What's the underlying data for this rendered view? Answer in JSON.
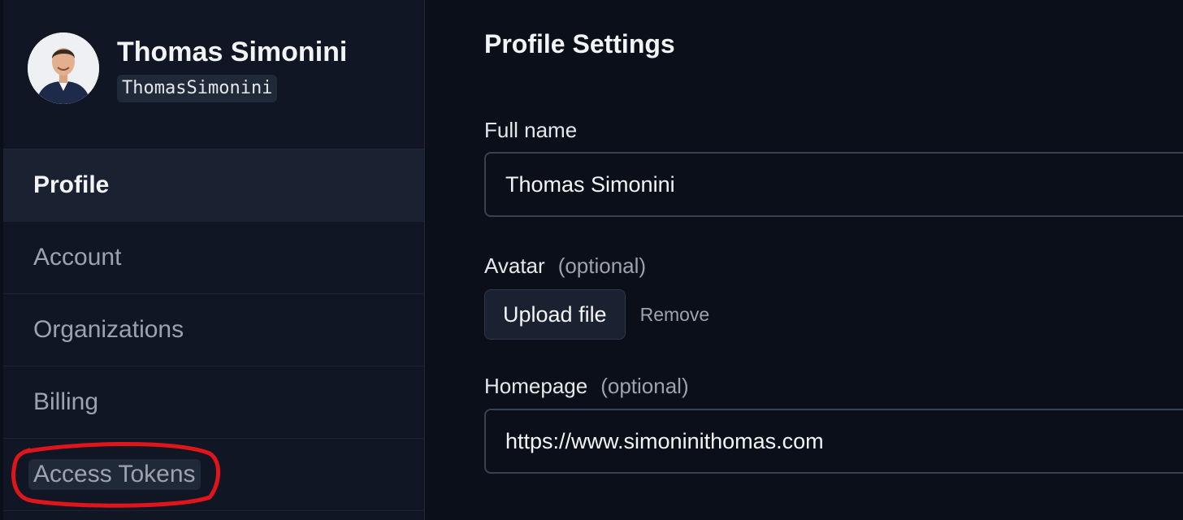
{
  "user": {
    "name": "Thomas Simonini",
    "handle": "ThomasSimonini"
  },
  "sidebar": {
    "items": [
      {
        "label": "Profile",
        "active": true
      },
      {
        "label": "Account"
      },
      {
        "label": "Organizations"
      },
      {
        "label": "Billing"
      },
      {
        "label": "Access Tokens",
        "highlighted": true
      }
    ]
  },
  "main": {
    "title": "Profile Settings",
    "full_name": {
      "label": "Full name",
      "value": "Thomas Simonini"
    },
    "avatar": {
      "label": "Avatar",
      "optional": "(optional)",
      "upload_label": "Upload file",
      "remove_label": "Remove"
    },
    "homepage": {
      "label": "Homepage",
      "optional": "(optional)",
      "value": "https://www.simoninithomas.com"
    }
  },
  "colors": {
    "background": "#0b0f19",
    "sidebar": "#101624",
    "active_item": "#1a2232",
    "annotation": "#e0141b"
  }
}
